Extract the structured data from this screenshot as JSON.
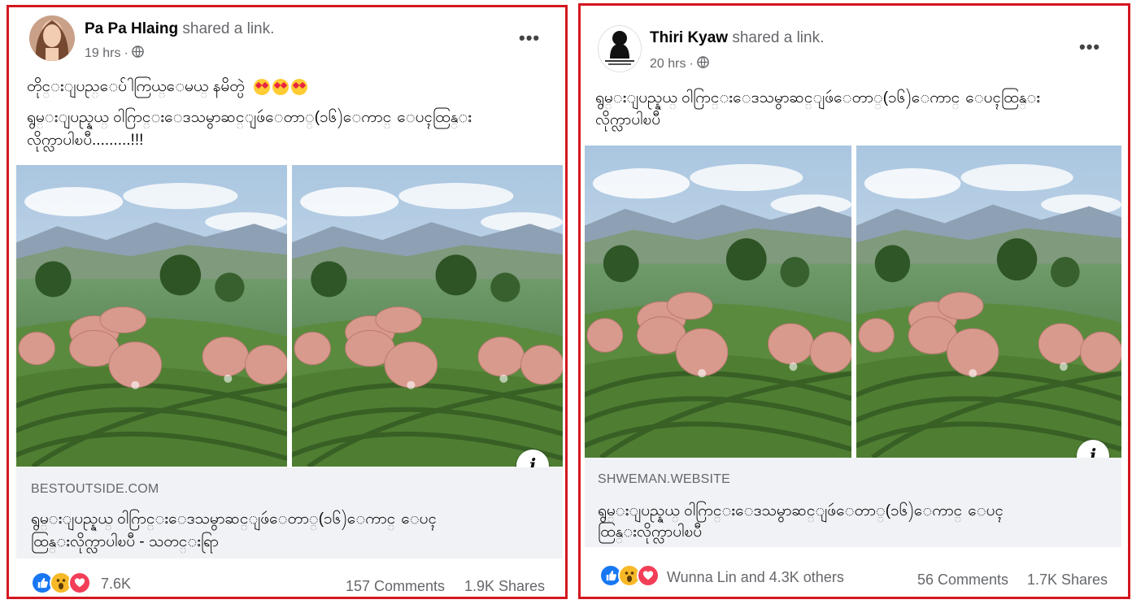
{
  "posts": [
    {
      "author": "Pa Pa Hlaing",
      "action": "shared a link.",
      "time": "19 hrs",
      "caption_line1": "တိုင္းျပည္ေပ်ါကြယ္ေမယ္ နမိတ္ပဲ",
      "caption_line2": "ရွမ္းျပည္နယ္ ဝါဂြာင္းေဒသမွာဆင္ျဖဴေတာ္(၁၆)ေကာင္ ေပၚထြန္း",
      "caption_line3": "လိုက္လာပါၿပီ.........!!!",
      "domain": "BESTOUTSIDE.COM",
      "link_title_line1": "ရွမ္းျပည္နယ္ ဝါဂြာင္းေဒသမွာဆင္ျဖဴေတာ္(၁၆)ေကာင္ ေပၚ",
      "link_title_line2": "ထြန္းလိုက္လာပါၿပီ - သတင္းရြာ",
      "reaction_count": "7.6K",
      "comments": "157 Comments",
      "shares": "1.9K Shares"
    },
    {
      "author": "Thiri Kyaw",
      "action": "shared a link.",
      "time": "20 hrs",
      "caption_line1": "ရွမ္းျပည္နယ္ ဝါဂြာင္းေဒသမွာဆင္ျဖဴေတာ္(၁၆)ေကာင္ ေပၚထြန္း",
      "caption_line2": "လိုက္လာပါၿပီ",
      "domain": "SHWEMAN.WEBSITE",
      "link_title_line1": "ရွမ္းျပည္နယ္ ဝါဂြာင္းေဒသမွာဆင္ျဖဴေတာ္(၁၆)ေကာင္ ေပၚ",
      "link_title_line2": "ထြန္းလိုက္လာပါၿပီ",
      "reaction_count": "Wunna Lin and 4.3K others",
      "comments": "56 Comments",
      "shares": "1.7K Shares"
    }
  ],
  "colors": {
    "frame": "#d4171f",
    "meta_text": "#65676b",
    "link_bg": "#f0f2f5",
    "like": "#1877f2",
    "wow": "#f7b928",
    "love": "#f33e58"
  },
  "icons": [
    "globe-icon",
    "more-options-icon",
    "info-icon",
    "like-icon",
    "wow-icon",
    "love-icon",
    "heart-eyes-emoji"
  ]
}
